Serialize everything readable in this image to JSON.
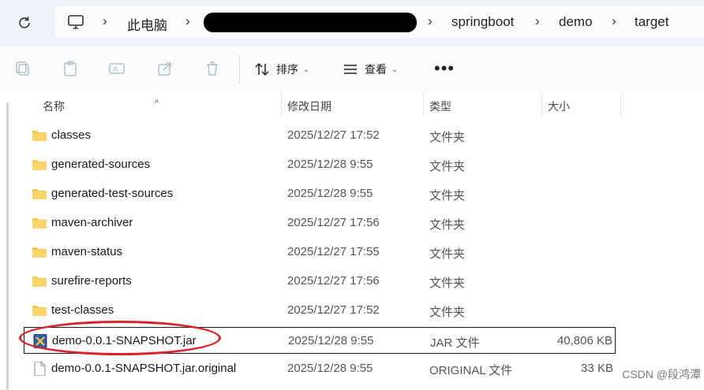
{
  "address_bar": {
    "crumbs": [
      "此电脑",
      "springboot",
      "demo",
      "target"
    ]
  },
  "toolbar": {
    "sort_label": "排序",
    "view_label": "查看",
    "more_label": "•••"
  },
  "columns": {
    "name": "名称",
    "modified": "修改日期",
    "type": "类型",
    "size": "大小"
  },
  "files": [
    {
      "name": "classes",
      "modified": "2025/12/27 17:52",
      "type": "文件夹",
      "size": "",
      "kind": "folder"
    },
    {
      "name": "generated-sources",
      "modified": "2025/12/28 9:55",
      "type": "文件夹",
      "size": "",
      "kind": "folder"
    },
    {
      "name": "generated-test-sources",
      "modified": "2025/12/28 9:55",
      "type": "文件夹",
      "size": "",
      "kind": "folder"
    },
    {
      "name": "maven-archiver",
      "modified": "2025/12/27 17:56",
      "type": "文件夹",
      "size": "",
      "kind": "folder"
    },
    {
      "name": "maven-status",
      "modified": "2025/12/27 17:55",
      "type": "文件夹",
      "size": "",
      "kind": "folder"
    },
    {
      "name": "surefire-reports",
      "modified": "2025/12/27 17:56",
      "type": "文件夹",
      "size": "",
      "kind": "folder"
    },
    {
      "name": "test-classes",
      "modified": "2025/12/27 17:52",
      "type": "文件夹",
      "size": "",
      "kind": "folder"
    },
    {
      "name": "demo-0.0.1-SNAPSHOT.jar",
      "modified": "2025/12/28 9:55",
      "type": "JAR 文件",
      "size": "40,806 KB",
      "kind": "jar"
    },
    {
      "name": "demo-0.0.1-SNAPSHOT.jar.original",
      "modified": "2025/12/28 9:55",
      "type": "ORIGINAL 文件",
      "size": "33 KB",
      "kind": "file"
    }
  ],
  "watermark": "CSDN @段鸿潭",
  "colors": {
    "folder": "#f7c948",
    "annotation": "#d8232a",
    "address_bg": "#eef3f9"
  }
}
